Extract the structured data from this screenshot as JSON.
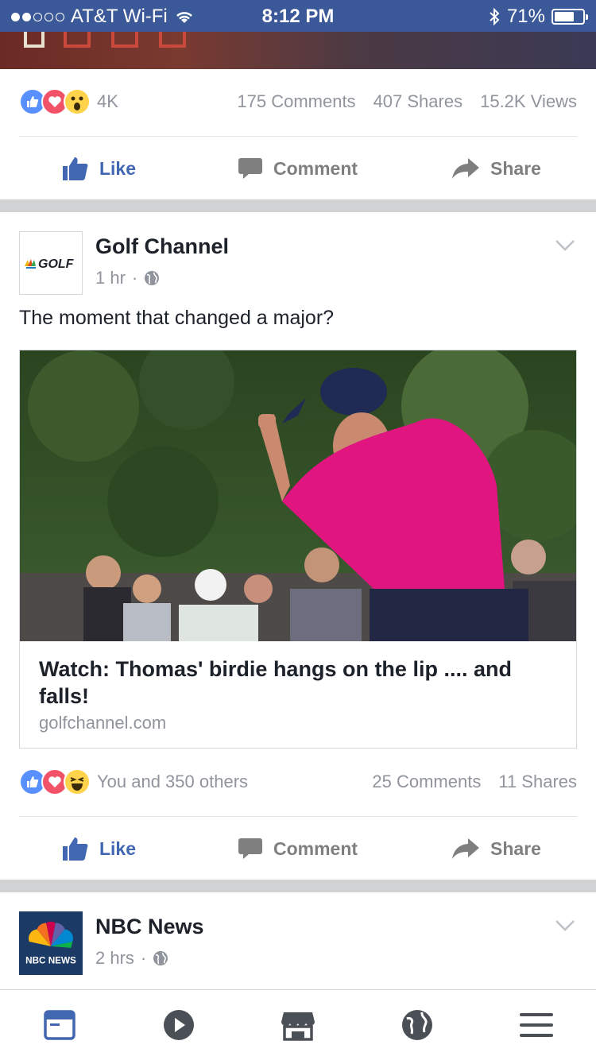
{
  "status_bar": {
    "carrier": "AT&T Wi-Fi",
    "time": "8:12 PM",
    "battery": "71%",
    "battery_level": 0.71,
    "signal_dots_filled": 2,
    "signal_dots_total": 5
  },
  "previous_post": {
    "reaction_count": "4K",
    "comments": "175 Comments",
    "shares": "407 Shares",
    "views": "15.2K Views",
    "reactions": [
      "like-icon",
      "love-icon",
      "wow-icon"
    ]
  },
  "actions": {
    "like": "Like",
    "comment": "Comment",
    "share": "Share"
  },
  "post": {
    "page_name": "Golf Channel",
    "time": "1 hr",
    "separator": "·",
    "avatar_text": "GOLF",
    "text": "The moment that changed a major?",
    "link": {
      "title": "Watch: Thomas' birdie hangs on the lip .... and falls!",
      "domain": "golfchannel.com",
      "media_description_icon": "video-thumbnail"
    },
    "reaction_text": "You and 350 others",
    "comments": "25 Comments",
    "shares": "11 Shares",
    "reactions": [
      "like-icon",
      "love-icon",
      "haha-icon"
    ]
  },
  "next_post": {
    "page_name": "NBC News",
    "time": "2 hrs",
    "separator": "·",
    "avatar_text": "NBC NEWS"
  },
  "bottom_nav": [
    "news-feed-icon",
    "video-icon",
    "marketplace-icon",
    "notifications-globe-icon",
    "menu-icon"
  ],
  "colors": {
    "brand": "#3b5998",
    "like_blue": "#4267b2",
    "love_red": "#f25268",
    "reaction_yellow": "#ffd34c",
    "muted_text": "#90949c",
    "separator_gray": "#d1d2d4",
    "polo_pink": "#e0157f"
  }
}
